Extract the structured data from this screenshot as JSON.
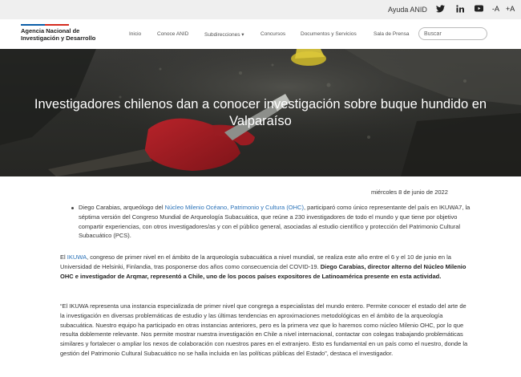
{
  "topbar": {
    "help": "Ayuda ANID",
    "icons": [
      "twitter-icon",
      "linkedin-icon",
      "youtube-icon"
    ],
    "font_decrease": "-A",
    "font_increase": "+A"
  },
  "brand": {
    "line1": "Agencia Nacional de",
    "line2": "Investigación y Desarrollo",
    "colors": {
      "blue": "#0b5ea8",
      "red": "#d52b1e"
    }
  },
  "nav": {
    "items": [
      "Inicio",
      "Conoce ANID",
      "Subdirecciones",
      "Concursos",
      "Documentos y Servicios",
      "Sala de Prensa"
    ],
    "dropdown_marker": "▾",
    "search_placeholder": "Buscar"
  },
  "hero": {
    "title_line1": "Investigadores chilenos dan a conocer investigación sobre buque hundido en",
    "title_line2": "Valparaíso"
  },
  "article": {
    "date": "miércoles 8 de junio de 2022",
    "bullet": {
      "pre": "Diego Carabias, arqueólogo del ",
      "link": "Núcleo Milenio Océano, Patrimonio y Cultura (OHC)",
      "post": ", participaró como único representante del país en IKUWA7, la séptima versión del Congreso Mundial de Arqueología Subacuática, que reúne a 230 investigadores de todo el mundo y que tiene por objetivo compartir experiencias, con otros investigadores/as y con el público general, asociadas al estudio científico y protección del Patrimonio Cultural Subacuático (PCS)."
    },
    "p1": {
      "pre": "El ",
      "link": "IKUWA",
      "mid": ", congreso de primer nivel en el ámbito de la arqueología subacuática a nivel mundial, se realiza este año entre el 6 y el 10 de junio en la Universidad de Helsinki, Finlandia, tras posponerse dos años como consecuencia del COVID-19. ",
      "bold": "Diego Carabias, director alterno del Núcleo Milenio OHC e investigador de Arqmar, representó a Chile, uno de los pocos  países expositores de Latinoamérica presente en esta actividad."
    },
    "p2": {
      "pre": "“El IKUWA representa una instancia especializada de primer nivel que congrega a especialistas del mundo entero. Permite conocer el estado del arte de la investigación en diversas problemáticas de estudio y las últimas tendencias en aproximaciones metodológicas en el ámbito de la arqueología subacuática. Nuestro equipo ha participado en otras instancias anteriores, pero es la primera vez que lo haremos como núcleo Milenio OHC, por lo que resulta doblemente relevante. Nos permite mostrar nuestra investigación en Chile a nivel internacional, contactar con colegas trabajando problemáticas similares y fortalecer o ampliar los nexos de colaboración con nuestros pares en el extranjero. Esto es fundamental en un país como el nuestro, donde la gestión del Patrimonio Cultural Subacuático no se halla incluida en las políticas públicas del Estado”",
      "post": ", destaca el investigador."
    }
  }
}
